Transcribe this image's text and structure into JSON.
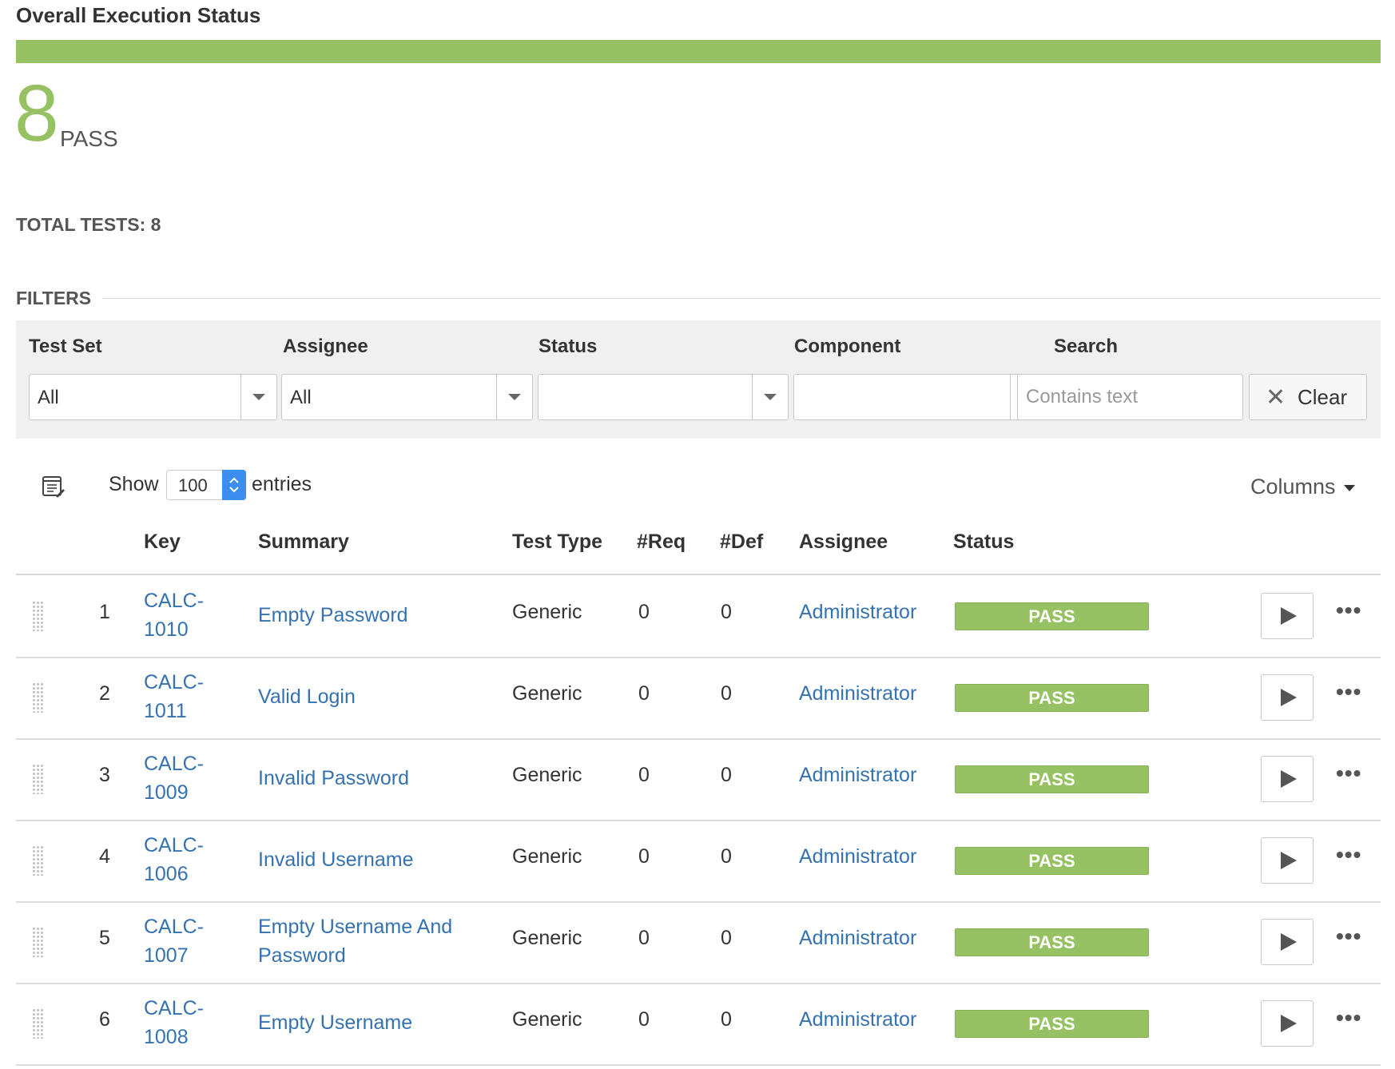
{
  "title": "Overall Execution Status",
  "status_bar": {
    "pass_fraction": 1.0,
    "color": "#97c264"
  },
  "summary": {
    "count": "8",
    "label": "PASS"
  },
  "total_tests": "TOTAL TESTS: 8",
  "filters": {
    "heading": "FILTERS",
    "test_set": {
      "label": "Test Set",
      "value": "All"
    },
    "assignee": {
      "label": "Assignee",
      "value": "All"
    },
    "status": {
      "label": "Status",
      "value": ""
    },
    "component": {
      "label": "Component",
      "value": ""
    },
    "search": {
      "label": "Search",
      "placeholder": "Contains text",
      "value": ""
    },
    "clear_label": "Clear"
  },
  "table_controls": {
    "show_label": "Show",
    "entries_value": "100",
    "entries_label": "entries",
    "columns_label": "Columns"
  },
  "columns": {
    "key": "Key",
    "summary": "Summary",
    "test_type": "Test Type",
    "req": "#Req",
    "def": "#Def",
    "assignee": "Assignee",
    "status": "Status"
  },
  "rows": [
    {
      "rank": "1",
      "key_line1": "CALC-",
      "key_line2": "1010",
      "summary": "Empty Password",
      "test_type": "Generic",
      "req": "0",
      "def": "0",
      "assignee": "Administrator",
      "status": "PASS"
    },
    {
      "rank": "2",
      "key_line1": "CALC-",
      "key_line2": "1011",
      "summary": "Valid Login",
      "test_type": "Generic",
      "req": "0",
      "def": "0",
      "assignee": "Administrator",
      "status": "PASS"
    },
    {
      "rank": "3",
      "key_line1": "CALC-",
      "key_line2": "1009",
      "summary": "Invalid Password",
      "test_type": "Generic",
      "req": "0",
      "def": "0",
      "assignee": "Administrator",
      "status": "PASS"
    },
    {
      "rank": "4",
      "key_line1": "CALC-",
      "key_line2": "1006",
      "summary": "Invalid Username",
      "test_type": "Generic",
      "req": "0",
      "def": "0",
      "assignee": "Administrator",
      "status": "PASS"
    },
    {
      "rank": "5",
      "key_line1": "CALC-",
      "key_line2": "1007",
      "summary": "Empty Username And Password",
      "test_type": "Generic",
      "req": "0",
      "def": "0",
      "assignee": "Administrator",
      "status": "PASS"
    },
    {
      "rank": "6",
      "key_line1": "CALC-",
      "key_line2": "1008",
      "summary": "Empty Username",
      "test_type": "Generic",
      "req": "0",
      "def": "0",
      "assignee": "Administrator",
      "status": "PASS"
    }
  ],
  "icons": {
    "table_settings": "table-settings-icon",
    "dropdown": "chevron-down-icon",
    "clear": "close-icon",
    "play": "play-icon",
    "more": "more-icon",
    "drag": "drag-handle-icon"
  }
}
